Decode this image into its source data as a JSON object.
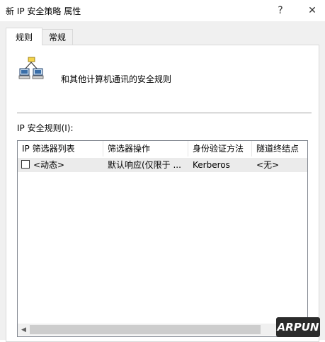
{
  "window": {
    "title": "新 IP 安全策略 属性",
    "help_symbol": "?",
    "close_symbol": "✕"
  },
  "tabs": [
    {
      "label": "规则",
      "active": true
    },
    {
      "label": "常规",
      "active": false
    }
  ],
  "rules_page": {
    "icon": "network-computers-icon",
    "heading": "和其他计算机通讯的安全规则",
    "list_label": "IP 安全规则(I):",
    "columns": [
      "IP 筛选器列表",
      "筛选器操作",
      "身份验证方法",
      "隧道终结点"
    ],
    "rows": [
      {
        "checked": false,
        "filter_list": "<动态>",
        "filter_action": "默认响应(仅限于 ...",
        "auth_method": "Kerberos",
        "tunnel_endpoint": "<无>"
      }
    ]
  },
  "scrollbar": {
    "left_arrow": "◀",
    "right_arrow": "▶"
  },
  "watermark": {
    "text": "ARPUN"
  }
}
